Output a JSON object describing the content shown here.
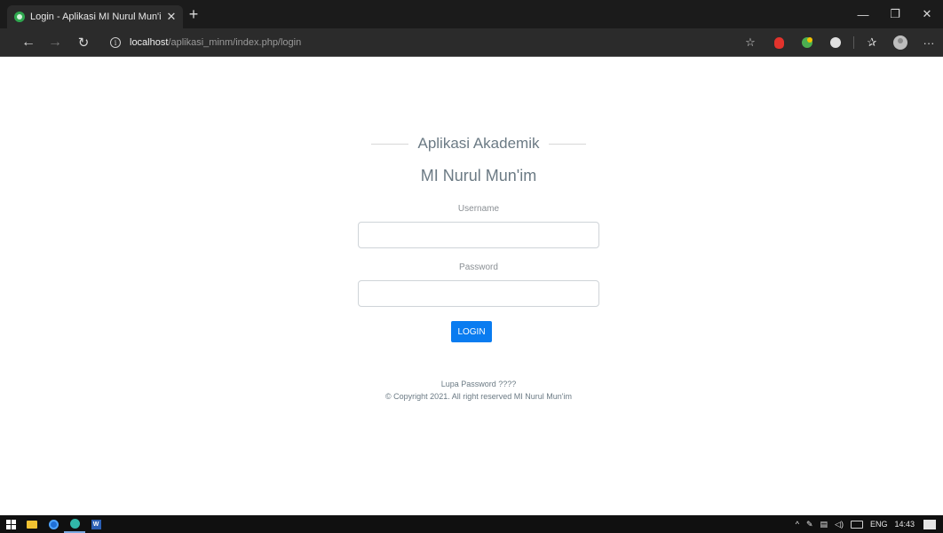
{
  "browser": {
    "tab": {
      "title": "Login - Aplikasi MI Nurul Mun'im",
      "close_glyph": "✕"
    },
    "new_tab_glyph": "+",
    "window_controls": {
      "minimize": "—",
      "maximize": "❐",
      "close": "✕"
    },
    "nav": {
      "back": "←",
      "forward": "→",
      "reload": "↻"
    },
    "address": {
      "info_glyph": "i",
      "host": "localhost",
      "path": "/aplikasi_minm/index.php/login"
    },
    "toolbar": {
      "favorites_add": "☆",
      "collections": "✰",
      "more": "···"
    }
  },
  "login": {
    "app_title": "Aplikasi Akademik",
    "school_name": "MI Nurul Mun'im",
    "username_label": "Username",
    "username_value": "",
    "password_label": "Password",
    "password_value": "",
    "submit_label": "LOGIN",
    "forgot_link": "Lupa Password ????",
    "copyright": "© Copyright 2021. All right reserved MI Nurul Mun'im"
  },
  "taskbar": {
    "word_glyph": "W",
    "tray_chevron": "^",
    "language": "ENG",
    "time": "14:43"
  },
  "colors": {
    "accent": "#0a7cf0",
    "title_text": "#6b7a84",
    "browser_dark": "#2b2b2b"
  }
}
